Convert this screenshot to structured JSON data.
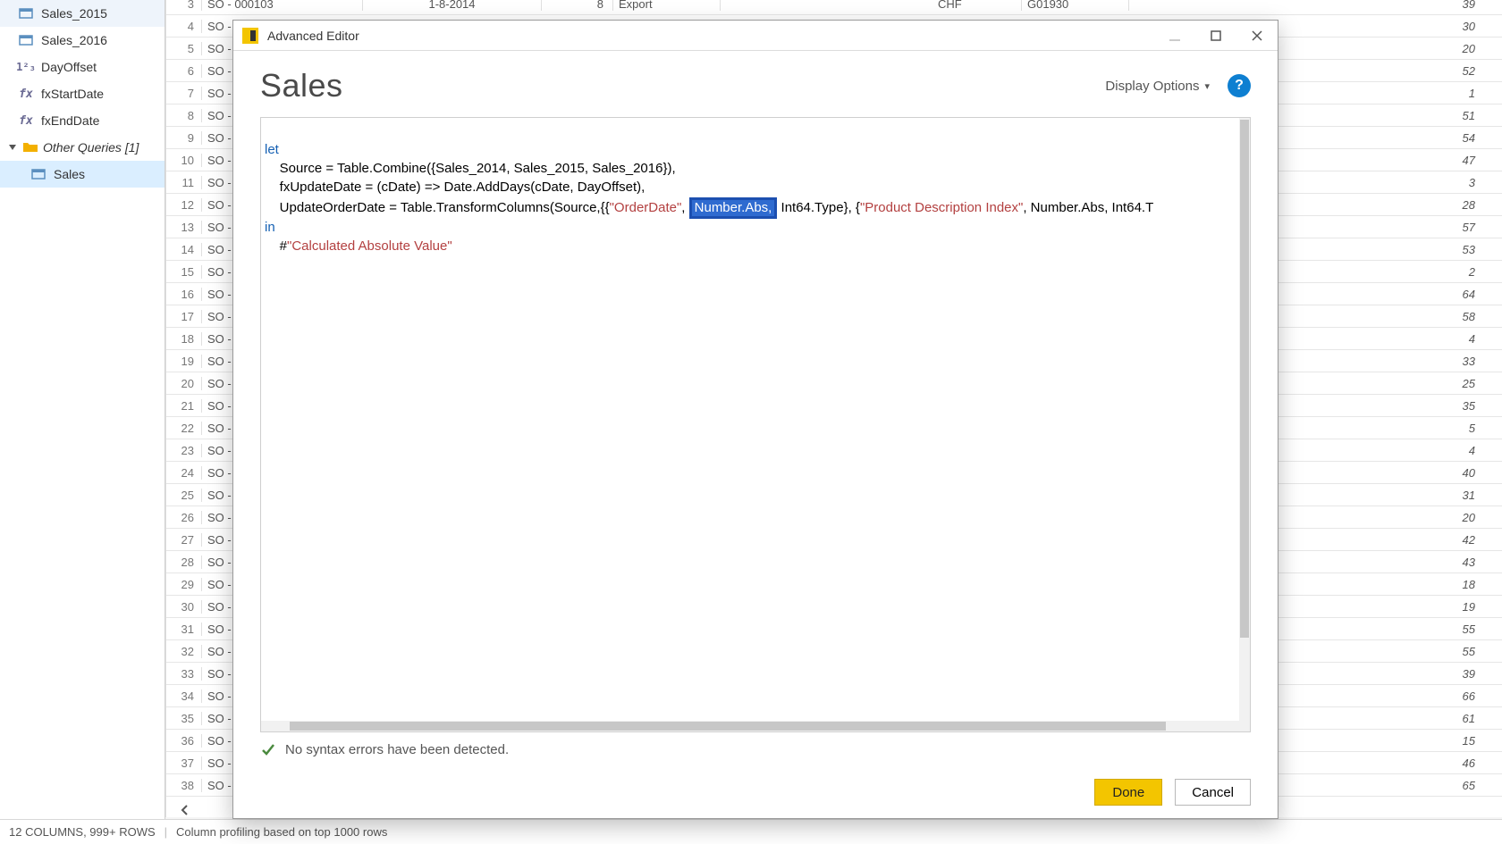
{
  "queries_pane": {
    "items": [
      {
        "type": "table",
        "label": "Sales_2015"
      },
      {
        "type": "table",
        "label": "Sales_2016"
      },
      {
        "type": "num",
        "label": "DayOffset"
      },
      {
        "type": "fx",
        "label": "fxStartDate"
      },
      {
        "type": "fx",
        "label": "fxEndDate"
      }
    ],
    "group": {
      "label": "Other Queries [1]"
    },
    "selected": {
      "label": "Sales"
    }
  },
  "grid": {
    "top_row": {
      "n": "3",
      "so": "SO - 000103",
      "date": "1-8-2014",
      "qty": "8",
      "type": "Export",
      "cur": "CHF",
      "code": "G01930",
      "right": "39"
    },
    "rows": [
      {
        "n": "4",
        "right": "30"
      },
      {
        "n": "5",
        "right": "20"
      },
      {
        "n": "6",
        "right": "52"
      },
      {
        "n": "7",
        "right": "1"
      },
      {
        "n": "8",
        "right": "51"
      },
      {
        "n": "9",
        "right": "54"
      },
      {
        "n": "10",
        "right": "47"
      },
      {
        "n": "11",
        "right": "3"
      },
      {
        "n": "12",
        "right": "28"
      },
      {
        "n": "13",
        "right": "57"
      },
      {
        "n": "14",
        "right": "53"
      },
      {
        "n": "15",
        "right": "2"
      },
      {
        "n": "16",
        "right": "64"
      },
      {
        "n": "17",
        "right": "58"
      },
      {
        "n": "18",
        "right": "4"
      },
      {
        "n": "19",
        "right": "33"
      },
      {
        "n": "20",
        "right": "25"
      },
      {
        "n": "21",
        "right": "35"
      },
      {
        "n": "22",
        "right": "5"
      },
      {
        "n": "23",
        "right": "4"
      },
      {
        "n": "24",
        "right": "40"
      },
      {
        "n": "25",
        "right": "31"
      },
      {
        "n": "26",
        "right": "20"
      },
      {
        "n": "27",
        "right": "42"
      },
      {
        "n": "28",
        "right": "43"
      },
      {
        "n": "29",
        "right": "18"
      },
      {
        "n": "30",
        "right": "19"
      },
      {
        "n": "31",
        "right": "55"
      },
      {
        "n": "32",
        "right": "55"
      },
      {
        "n": "33",
        "right": "39"
      },
      {
        "n": "34",
        "right": "66"
      },
      {
        "n": "35",
        "right": "61"
      },
      {
        "n": "36",
        "right": "15"
      },
      {
        "n": "37",
        "right": "46"
      },
      {
        "n": "38",
        "right": "65"
      }
    ],
    "so_prefix": "SO - "
  },
  "modal": {
    "title": "Advanced Editor",
    "query_name": "Sales",
    "display_options": "Display Options",
    "code": {
      "let": "let",
      "l1a": "    Source = Table.Combine({Sales_2014, Sales_2015, Sales_2016}),",
      "l2a": "    fxUpdateDate = (cDate) => Date.AddDays(cDate, DayOffset),",
      "l3a": "    UpdateOrderDate = Table.TransformColumns(Source,{{",
      "l3s1": "\"OrderDate\"",
      "l3m1": ", ",
      "l3sel": "Number.Abs,",
      "l3m2": " Int64.Type}, {",
      "l3s2": "\"Product Description Index\"",
      "l3m3": ", Number.Abs, Int64.T",
      "in": "in",
      "l4a": "    #",
      "l4s": "\"Calculated Absolute Value\""
    },
    "syntax_ok": "No syntax errors have been detected.",
    "done": "Done",
    "cancel": "Cancel"
  },
  "status": {
    "columns_rows": "12 COLUMNS, 999+ ROWS",
    "profiling": "Column profiling based on top 1000 rows"
  }
}
